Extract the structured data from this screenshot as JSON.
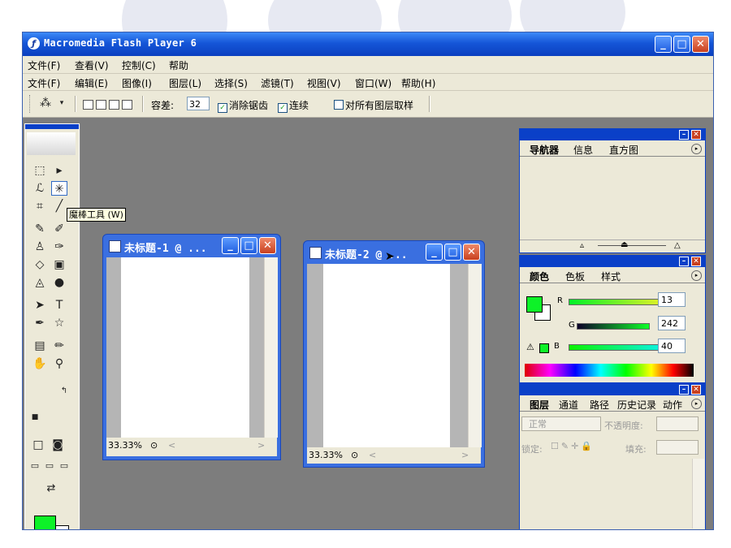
{
  "flash_window": {
    "title": "Macromedia Flash Player 6",
    "controls": {
      "minimize": "_",
      "maximize": "□",
      "close": "✕"
    }
  },
  "flash_menu": [
    "文件(F)",
    "查看(V)",
    "控制(C)",
    "帮助"
  ],
  "ps_menu": [
    "文件(F)",
    "编辑(E)",
    "图像(I)",
    "图层(L)",
    "选择(S)",
    "滤镜(T)",
    "视图(V)",
    "窗口(W)",
    "帮助(H)"
  ],
  "options_bar": {
    "tolerance_label": "容差:",
    "tolerance_value": "32",
    "antialias_label": "消除锯齿",
    "antialias_checked": true,
    "contiguous_label": "连续",
    "contiguous_checked": true,
    "sample_all_label": "对所有图层取样",
    "sample_all_checked": false
  },
  "toolbox": {
    "tooltip": "魔棒工具 (W)",
    "foreground_color": "#0df228",
    "background_color": "#ffffff"
  },
  "documents": [
    {
      "title": "未标题-1 @ ...",
      "zoom": "33.33%"
    },
    {
      "title": "未标题-2 @ ...",
      "zoom": "33.33%"
    }
  ],
  "navigator_panel": {
    "tabs": [
      "导航器",
      "信息",
      "直方图"
    ]
  },
  "color_panel": {
    "tabs": [
      "颜色",
      "色板",
      "样式"
    ],
    "channels": [
      {
        "label": "R",
        "value": "13",
        "fraction": 0.051
      },
      {
        "label": "G",
        "value": "242",
        "fraction": 0.949
      },
      {
        "label": "B",
        "value": "40",
        "fraction": 0.157
      }
    ],
    "swatch_color": "#0df228"
  },
  "layers_panel": {
    "tabs": [
      "图层",
      "通道",
      "路径",
      "历史记录",
      "动作"
    ],
    "blend_mode": "正常",
    "opacity_label": "不透明度:",
    "lock_label": "锁定:",
    "fill_label": "填充:"
  }
}
